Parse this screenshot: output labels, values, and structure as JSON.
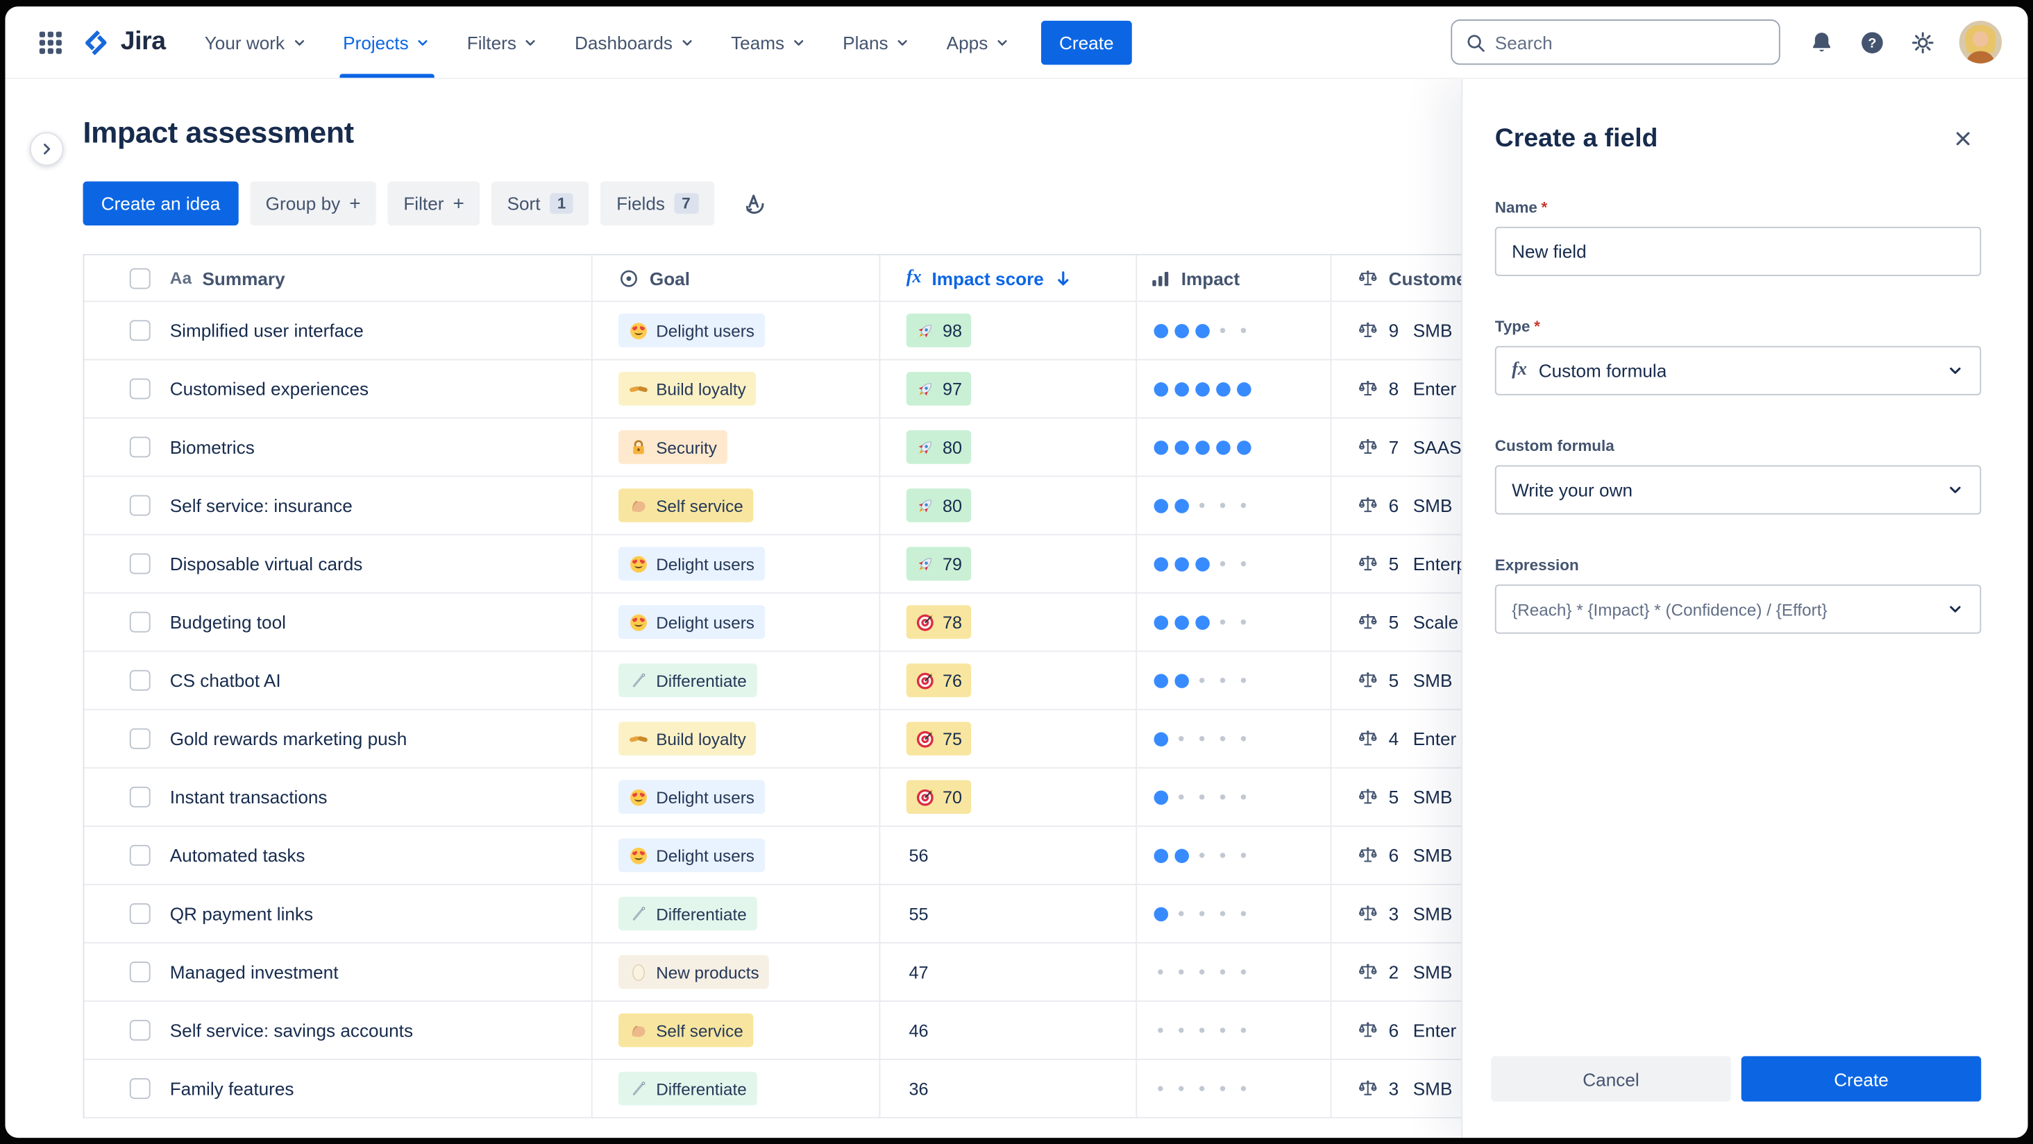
{
  "colors": {
    "accent": "#0C66E4",
    "text": "#172B4D",
    "text_subtle": "#44546F",
    "score_green": "#C9F0D5",
    "score_yellow": "#F8E6A0",
    "dot_filled": "#388BFF",
    "dot_empty": "#C2C8D2"
  },
  "icons": {
    "formula_glyph": "fx",
    "text_glyph": "Aa",
    "plus_glyph": "+"
  },
  "header": {
    "logo": "Jira",
    "nav": [
      {
        "label": "Your work"
      },
      {
        "label": "Projects",
        "active": true
      },
      {
        "label": "Filters"
      },
      {
        "label": "Dashboards"
      },
      {
        "label": "Teams"
      },
      {
        "label": "Plans"
      },
      {
        "label": "Apps"
      }
    ],
    "create_button": "Create",
    "search_placeholder": "Search"
  },
  "page": {
    "title": "Impact assessment",
    "toolbar": {
      "create_idea": "Create an idea",
      "group_by": "Group by",
      "filter": "Filter",
      "sort": "Sort",
      "sort_count": "1",
      "fields": "Fields",
      "fields_count": "7"
    }
  },
  "table": {
    "columns": [
      {
        "id": "summary",
        "label": "Summary"
      },
      {
        "id": "goal",
        "label": "Goal"
      },
      {
        "id": "impact_score",
        "label": "Impact score",
        "sort": "desc"
      },
      {
        "id": "impact",
        "label": "Impact"
      },
      {
        "id": "customer",
        "label": "Customer"
      }
    ],
    "rows": [
      {
        "summary": "Simplified user interface",
        "goal": {
          "label": "Delight users",
          "icon": "heart-eyes-emoji",
          "bg": "#E9F2FF"
        },
        "score": {
          "value": "98",
          "icon": "rocket-emoji",
          "style": "green"
        },
        "impact_dots": 3,
        "customer": {
          "value": "9",
          "label": "SMB"
        }
      },
      {
        "summary": "Customised experiences",
        "goal": {
          "label": "Build loyalty",
          "icon": "handshake-emoji",
          "bg": "#FBF1C4"
        },
        "score": {
          "value": "97",
          "icon": "rocket-emoji",
          "style": "green"
        },
        "impact_dots": 5,
        "customer": {
          "value": "8",
          "label": "Enter"
        }
      },
      {
        "summary": "Biometrics",
        "goal": {
          "label": "Security",
          "icon": "locked-with-key-emoji",
          "bg": "#FFE9CE"
        },
        "score": {
          "value": "80",
          "icon": "rocket-emoji",
          "style": "green"
        },
        "impact_dots": 5,
        "customer": {
          "value": "7",
          "label": "SAAS"
        }
      },
      {
        "summary": "Self service: insurance",
        "goal": {
          "label": "Self service",
          "icon": "flexed-biceps-emoji",
          "bg": "#F8E6A0"
        },
        "score": {
          "value": "80",
          "icon": "rocket-emoji",
          "style": "green"
        },
        "impact_dots": 2,
        "customer": {
          "value": "6",
          "label": "SMB"
        }
      },
      {
        "summary": "Disposable virtual cards",
        "goal": {
          "label": "Delight users",
          "icon": "heart-eyes-emoji",
          "bg": "#E9F2FF"
        },
        "score": {
          "value": "79",
          "icon": "rocket-emoji",
          "style": "green"
        },
        "impact_dots": 3,
        "customer": {
          "value": "5",
          "label": "Enterp"
        }
      },
      {
        "summary": "Budgeting tool",
        "goal": {
          "label": "Delight users",
          "icon": "heart-eyes-emoji",
          "bg": "#E9F2FF"
        },
        "score": {
          "value": "78",
          "icon": "dart-emoji",
          "style": "yellow"
        },
        "impact_dots": 3,
        "customer": {
          "value": "5",
          "label": "Scale"
        }
      },
      {
        "summary": "CS chatbot AI",
        "goal": {
          "label": "Differentiate",
          "icon": "needle-emoji",
          "bg": "#E2F6EC"
        },
        "score": {
          "value": "76",
          "icon": "dart-emoji",
          "style": "yellow"
        },
        "impact_dots": 2,
        "customer": {
          "value": "5",
          "label": "SMB"
        }
      },
      {
        "summary": "Gold rewards marketing push",
        "goal": {
          "label": "Build loyalty",
          "icon": "handshake-emoji",
          "bg": "#FBF1C4"
        },
        "score": {
          "value": "75",
          "icon": "dart-emoji",
          "style": "yellow"
        },
        "impact_dots": 1,
        "customer": {
          "value": "4",
          "label": "Enter"
        }
      },
      {
        "summary": "Instant transactions",
        "goal": {
          "label": "Delight users",
          "icon": "heart-eyes-emoji",
          "bg": "#E9F2FF"
        },
        "score": {
          "value": "70",
          "icon": "dart-emoji",
          "style": "yellow"
        },
        "impact_dots": 1,
        "customer": {
          "value": "5",
          "label": "SMB"
        }
      },
      {
        "summary": "Automated tasks",
        "goal": {
          "label": "Delight users",
          "icon": "heart-eyes-emoji",
          "bg": "#E9F2FF"
        },
        "score": {
          "value": "56",
          "icon": null,
          "style": null
        },
        "impact_dots": 2,
        "customer": {
          "value": "6",
          "label": "SMB"
        }
      },
      {
        "summary": "QR payment links",
        "goal": {
          "label": "Differentiate",
          "icon": "needle-emoji",
          "bg": "#E2F6EC"
        },
        "score": {
          "value": "55",
          "icon": null,
          "style": null
        },
        "impact_dots": 1,
        "customer": {
          "value": "3",
          "label": "SMB"
        }
      },
      {
        "summary": "Managed investment",
        "goal": {
          "label": "New products",
          "icon": "egg-emoji",
          "bg": "#F6EFE4"
        },
        "score": {
          "value": "47",
          "icon": null,
          "style": null
        },
        "impact_dots": 0,
        "customer": {
          "value": "2",
          "label": "SMB"
        }
      },
      {
        "summary": "Self service: savings accounts",
        "goal": {
          "label": "Self service",
          "icon": "flexed-biceps-emoji",
          "bg": "#F8E6A0"
        },
        "score": {
          "value": "46",
          "icon": null,
          "style": null
        },
        "impact_dots": 0,
        "customer": {
          "value": "6",
          "label": "Enter"
        }
      },
      {
        "summary": "Family features",
        "goal": {
          "label": "Differentiate",
          "icon": "needle-emoji",
          "bg": "#E2F6EC"
        },
        "score": {
          "value": "36",
          "icon": null,
          "style": null
        },
        "impact_dots": 0,
        "customer": {
          "value": "3",
          "label": "SMB"
        }
      }
    ]
  },
  "panel": {
    "title": "Create a field",
    "required_marker": "*",
    "name_label": "Name",
    "name_value": "New field",
    "type_label": "Type",
    "type_value": "Custom formula",
    "formula_label": "Custom formula",
    "formula_value": "Write your own",
    "expression_label": "Expression",
    "expression_value": "{Reach} * {Impact} * (Confidence) / {Effort}",
    "cancel_button": "Cancel",
    "create_button": "Create"
  }
}
